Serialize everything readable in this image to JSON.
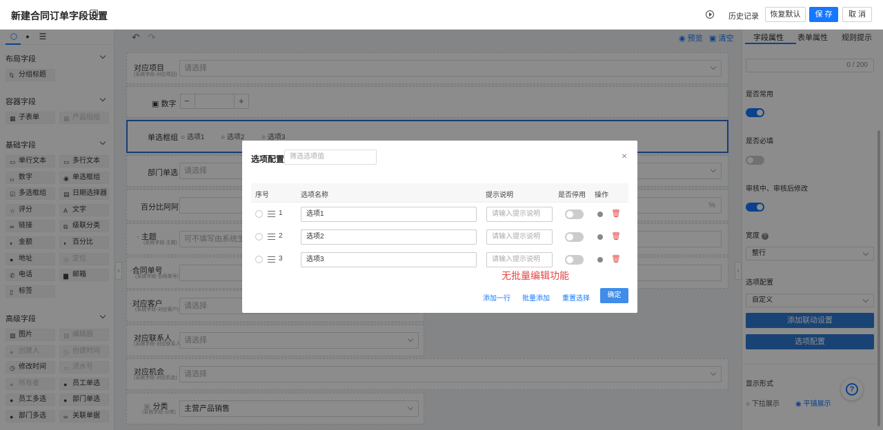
{
  "header": {
    "title": "新建合同订单字段设置",
    "history": "历史记录",
    "restore": "恢复默认",
    "save": "保 存",
    "cancel": "取 消"
  },
  "left": {
    "sections": [
      {
        "title": "布局字段",
        "items": [
          {
            "label": "分组标题",
            "icon": "Ⴉ",
            "disabled": false
          }
        ]
      },
      {
        "title": "容器字段",
        "items": [
          {
            "label": "子表单",
            "icon": "▦",
            "disabled": false
          },
          {
            "label": "产品组组",
            "icon": "▦",
            "disabled": true
          }
        ]
      },
      {
        "title": "基础字段",
        "items": [
          {
            "label": "单行文本",
            "icon": "▭",
            "disabled": false
          },
          {
            "label": "多行文本",
            "icon": "▭",
            "disabled": false
          },
          {
            "label": "数字",
            "icon": "₁₂",
            "disabled": false
          },
          {
            "label": "单选框组",
            "icon": "◉",
            "disabled": false
          },
          {
            "label": "多选框组",
            "icon": "☑",
            "disabled": false
          },
          {
            "label": "日期选择器",
            "icon": "▤",
            "disabled": false
          },
          {
            "label": "评分",
            "icon": "☆",
            "disabled": false
          },
          {
            "label": "文字",
            "icon": "A",
            "disabled": false
          },
          {
            "label": "链接",
            "icon": "∞",
            "disabled": false
          },
          {
            "label": "级联分类",
            "icon": "⧉",
            "disabled": false
          },
          {
            "label": "金额",
            "icon": "◐",
            "disabled": false
          },
          {
            "label": "百分比",
            "icon": "◐",
            "disabled": false
          },
          {
            "label": "地址",
            "icon": "●",
            "disabled": false
          },
          {
            "label": "定位",
            "icon": "◎",
            "disabled": true
          },
          {
            "label": "电话",
            "icon": "✆",
            "disabled": false
          },
          {
            "label": "邮箱",
            "icon": "▆",
            "disabled": false
          },
          {
            "label": "标签",
            "icon": "▯",
            "disabled": false
          }
        ]
      },
      {
        "title": "高级字段",
        "items": [
          {
            "label": "图片",
            "icon": "▨",
            "disabled": false
          },
          {
            "label": "编辑器",
            "icon": "▨",
            "disabled": true
          },
          {
            "label": "创建人",
            "icon": "●",
            "disabled": true
          },
          {
            "label": "创建时间",
            "icon": "◷",
            "disabled": true
          },
          {
            "label": "修改时间",
            "icon": "◷",
            "disabled": false
          },
          {
            "label": "流水号",
            "icon": "▭",
            "disabled": true
          },
          {
            "label": "所有者",
            "icon": "●",
            "disabled": true
          },
          {
            "label": "员工单选",
            "icon": "●",
            "disabled": false
          },
          {
            "label": "员工多选",
            "icon": "●",
            "disabled": false
          },
          {
            "label": "部门单选",
            "icon": "●",
            "disabled": false
          },
          {
            "label": "部门多选",
            "icon": "●",
            "disabled": false
          },
          {
            "label": "关联单据",
            "icon": "∞",
            "disabled": false
          }
        ]
      }
    ]
  },
  "canvas": {
    "preview": "预览",
    "clear": "清空",
    "fields": [
      {
        "label": "对应项目",
        "sub": "(系统字段-对应项目)",
        "value": "请选择"
      },
      {
        "label": "数字",
        "sub": "",
        "value": ""
      },
      {
        "label": "单选框组",
        "options": [
          "选项1",
          "选项2",
          "选项3"
        ]
      },
      {
        "label": "部门单选",
        "value": "请选择"
      },
      {
        "label": "百分比阿阿",
        "value": "%"
      },
      {
        "label": "主题",
        "sub": "(系统字段-主题)",
        "value": "可不填写由系统生成"
      },
      {
        "label": "合同单号",
        "sub": "(系统字段-合同单号)",
        "value": ""
      },
      {
        "label": "对应客户",
        "sub": "(系统字段-对应客户)",
        "value": "请选择"
      },
      {
        "label": "对应联系人",
        "sub": "(系统字段-对应联系人)",
        "value": "请选择"
      },
      {
        "label": "对应机会",
        "sub": "(系统字段-对应机会)",
        "value": "请选择"
      },
      {
        "label": "分类",
        "sub": "(系统字段-分类)",
        "value": "主营产品销售"
      }
    ]
  },
  "right": {
    "tabs": [
      "字段属性",
      "表单属性",
      "规则提示"
    ],
    "counter": "0 / 200",
    "common": "是否常用",
    "required": "是否必填",
    "edit_after": "审核中、审核后修改",
    "width": "宽度",
    "width_value": "整行",
    "option_config": "选项配置",
    "option_config_value": "自定义",
    "btn_linkage": "添加联动设置",
    "btn_options": "选项配置",
    "display": "显示形式",
    "display_options": [
      "下拉展示",
      "平铺展示"
    ]
  },
  "modal": {
    "title": "选项配置",
    "filter_placeholder": "筛选选项值",
    "columns": [
      "序号",
      "选项名称",
      "提示说明",
      "是否停用",
      "操作"
    ],
    "rows": [
      {
        "index": "1",
        "name": "选项1",
        "hint_placeholder": "请输入提示说明"
      },
      {
        "index": "2",
        "name": "选项2",
        "hint_placeholder": "请输入提示说明"
      },
      {
        "index": "3",
        "name": "选项3",
        "hint_placeholder": "请输入提示说明"
      }
    ],
    "annotation": "无批量编辑功能",
    "add_row": "添加一行",
    "batch_add": "批量添加",
    "reset": "重置选择",
    "ok": "确定"
  }
}
